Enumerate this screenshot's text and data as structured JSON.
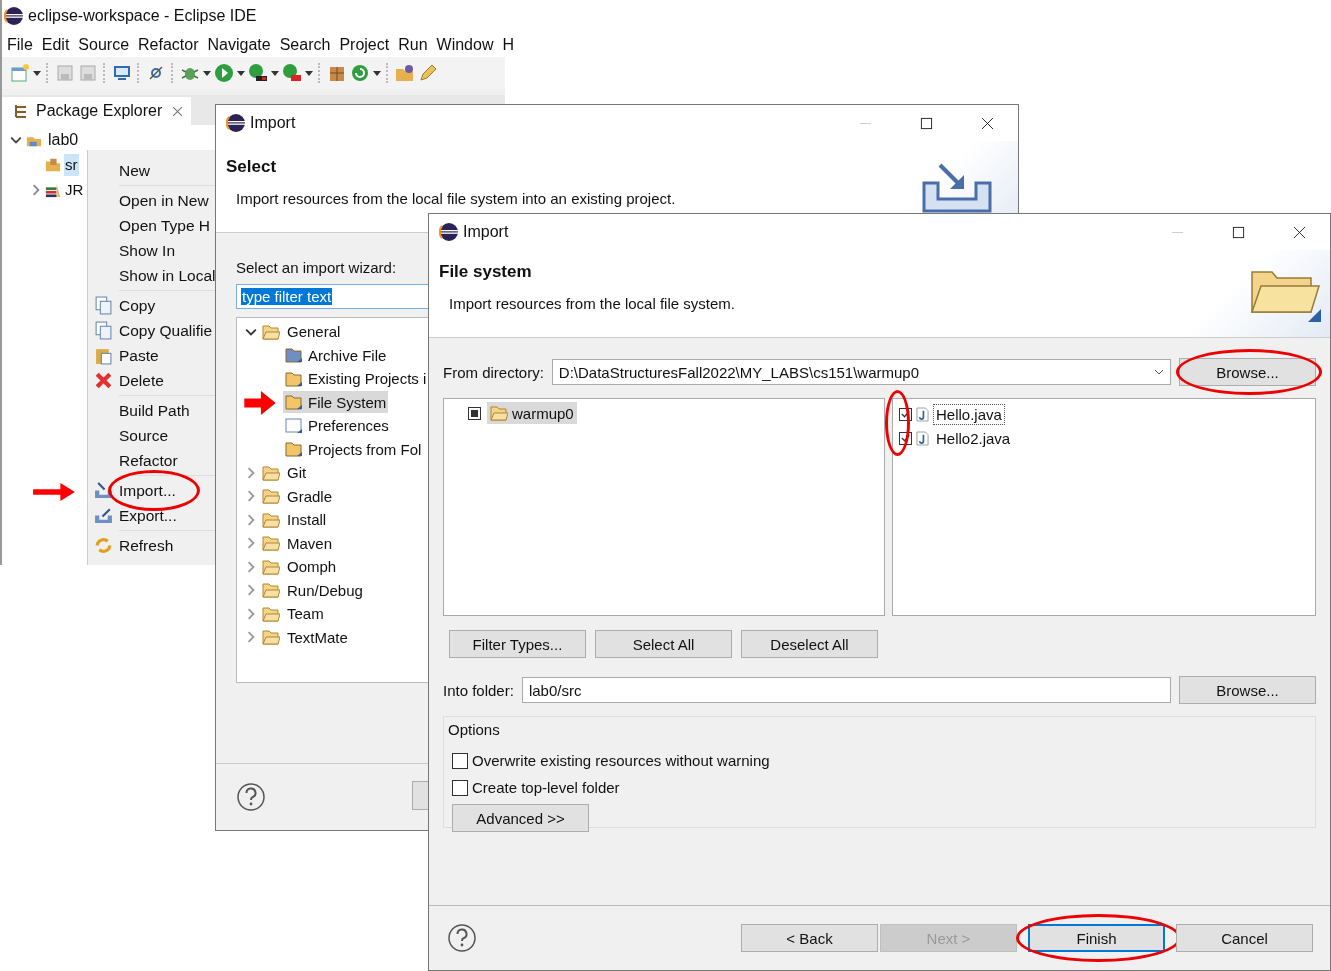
{
  "ide": {
    "title": "eclipse-workspace - Eclipse IDE",
    "menu": [
      "File",
      "Edit",
      "Source",
      "Refactor",
      "Navigate",
      "Search",
      "Project",
      "Run",
      "Window",
      "H"
    ],
    "view_tab": {
      "label": "Package Explorer"
    },
    "tree": [
      {
        "label": "lab0",
        "expanded": true,
        "selected": false,
        "children": [
          {
            "label": "sr",
            "selected": true
          },
          {
            "label": "JR",
            "expanded": false,
            "selected": false
          }
        ]
      }
    ]
  },
  "context_menu": {
    "groups": [
      [
        {
          "label": "New"
        }
      ],
      [
        {
          "label": "Open in New"
        },
        {
          "label": "Open Type H"
        },
        {
          "label": "Show In"
        },
        {
          "label": "Show in Local"
        }
      ],
      [
        {
          "label": "Copy"
        },
        {
          "label": "Copy Qualifie"
        },
        {
          "label": "Paste"
        },
        {
          "label": "Delete"
        }
      ],
      [
        {
          "label": "Build Path"
        },
        {
          "label": "Source"
        },
        {
          "label": "Refactor"
        }
      ],
      [
        {
          "label": "Import...",
          "circled": true,
          "arrowed": true
        },
        {
          "label": "Export..."
        }
      ],
      [
        {
          "label": "Refresh"
        }
      ]
    ]
  },
  "select_dialog": {
    "title": "Import",
    "heading": "Select",
    "description": "Import resources from the local file system into an existing project.",
    "filter_label": "Select an import wizard:",
    "filter_value": "type filter text",
    "tree": [
      {
        "label": "General",
        "expanded": true,
        "selected": false,
        "children": [
          {
            "label": "Archive File",
            "selected": false
          },
          {
            "label": "Existing Projects i",
            "selected": false
          },
          {
            "label": "File System",
            "selected": true,
            "arrowed": true
          },
          {
            "label": "Preferences",
            "selected": false
          },
          {
            "label": "Projects from Fol",
            "selected": false
          }
        ]
      },
      {
        "label": "Git",
        "expanded": false,
        "selected": false
      },
      {
        "label": "Gradle",
        "expanded": false,
        "selected": false
      },
      {
        "label": "Install",
        "expanded": false,
        "selected": false
      },
      {
        "label": "Maven",
        "expanded": false,
        "selected": false
      },
      {
        "label": "Oomph",
        "expanded": false,
        "selected": false
      },
      {
        "label": "Run/Debug",
        "expanded": false,
        "selected": false
      },
      {
        "label": "Team",
        "expanded": false,
        "selected": false
      },
      {
        "label": "TextMate",
        "expanded": false,
        "selected": false
      }
    ]
  },
  "file_dialog": {
    "title": "Import",
    "heading": "File system",
    "description": "Import resources from the local file system.",
    "from_label": "From directory:",
    "from_value": "D:\\DataStructuresFall2022\\MY_LABS\\cs151\\warmup0",
    "from_browse": {
      "label": "Browse...",
      "circled": true
    },
    "folders": [
      {
        "label": "warmup0",
        "checked": true,
        "grayed": true,
        "selected": true
      }
    ],
    "files_circled": true,
    "files": [
      {
        "label": "Hello.java",
        "checked": true,
        "selected": true
      },
      {
        "label": "Hello2.java",
        "checked": true,
        "selected": false
      }
    ],
    "select_buttons": [
      "Filter Types...",
      "Select All",
      "Deselect All"
    ],
    "into_label": "Into folder:",
    "into_value": "lab0/src",
    "into_browse": "Browse...",
    "options_title": "Options",
    "options": [
      {
        "label": "Overwrite existing resources without warning",
        "checked": false
      },
      {
        "label": "Create top-level folder",
        "checked": false
      }
    ],
    "advanced": "Advanced >>",
    "footer_buttons": [
      {
        "label": "< Back",
        "disabled": false,
        "default": false,
        "circled": false
      },
      {
        "label": "Next >",
        "disabled": true,
        "default": false,
        "circled": false
      },
      {
        "label": "Finish",
        "disabled": false,
        "default": true,
        "circled": true
      },
      {
        "label": "Cancel",
        "disabled": false,
        "default": false,
        "circled": false
      }
    ]
  }
}
